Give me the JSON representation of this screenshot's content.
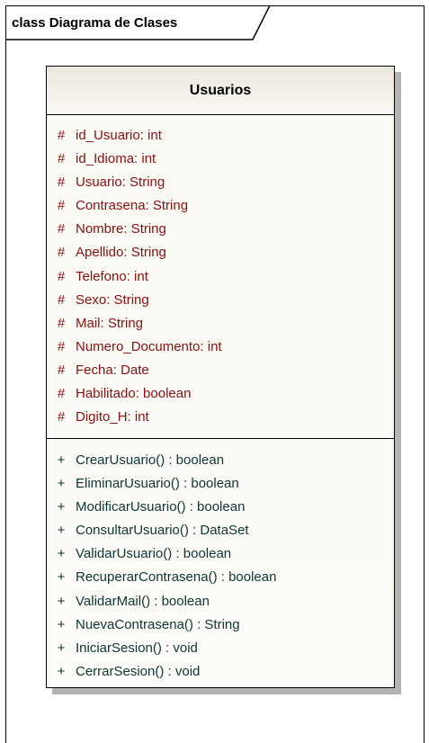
{
  "frame": {
    "label": "class Diagrama de Clases"
  },
  "class": {
    "name": "Usuarios",
    "attributes": [
      {
        "vis": "#",
        "text": "id_Usuario: int"
      },
      {
        "vis": "#",
        "text": "id_Idioma: int"
      },
      {
        "vis": "#",
        "text": "Usuario: String"
      },
      {
        "vis": "#",
        "text": "Contrasena: String"
      },
      {
        "vis": "#",
        "text": "Nombre: String"
      },
      {
        "vis": "#",
        "text": "Apellido: String"
      },
      {
        "vis": "#",
        "text": "Telefono: int"
      },
      {
        "vis": "#",
        "text": "Sexo: String"
      },
      {
        "vis": "#",
        "text": "Mail: String"
      },
      {
        "vis": "#",
        "text": "Numero_Documento: int"
      },
      {
        "vis": "#",
        "text": "Fecha: Date"
      },
      {
        "vis": "#",
        "text": "Habilitado: boolean"
      },
      {
        "vis": "#",
        "text": "Digito_H: int"
      }
    ],
    "operations": [
      {
        "vis": "+",
        "text": "CrearUsuario() : boolean"
      },
      {
        "vis": "+",
        "text": "EliminarUsuario() : boolean"
      },
      {
        "vis": "+",
        "text": "ModificarUsuario() : boolean"
      },
      {
        "vis": "+",
        "text": "ConsultarUsuario() : DataSet"
      },
      {
        "vis": "+",
        "text": "ValidarUsuario() : boolean"
      },
      {
        "vis": "+",
        "text": "RecuperarContrasena() : boolean"
      },
      {
        "vis": "+",
        "text": "ValidarMail() : boolean"
      },
      {
        "vis": "+",
        "text": "NuevaContrasena() : String"
      },
      {
        "vis": "+",
        "text": "IniciarSesion() : void"
      },
      {
        "vis": "+",
        "text": "CerrarSesion() : void"
      }
    ]
  },
  "colors": {
    "attribute_text": "#8b1010",
    "operation_text": "#0e3535",
    "class_fill": "#fdfbf7"
  }
}
